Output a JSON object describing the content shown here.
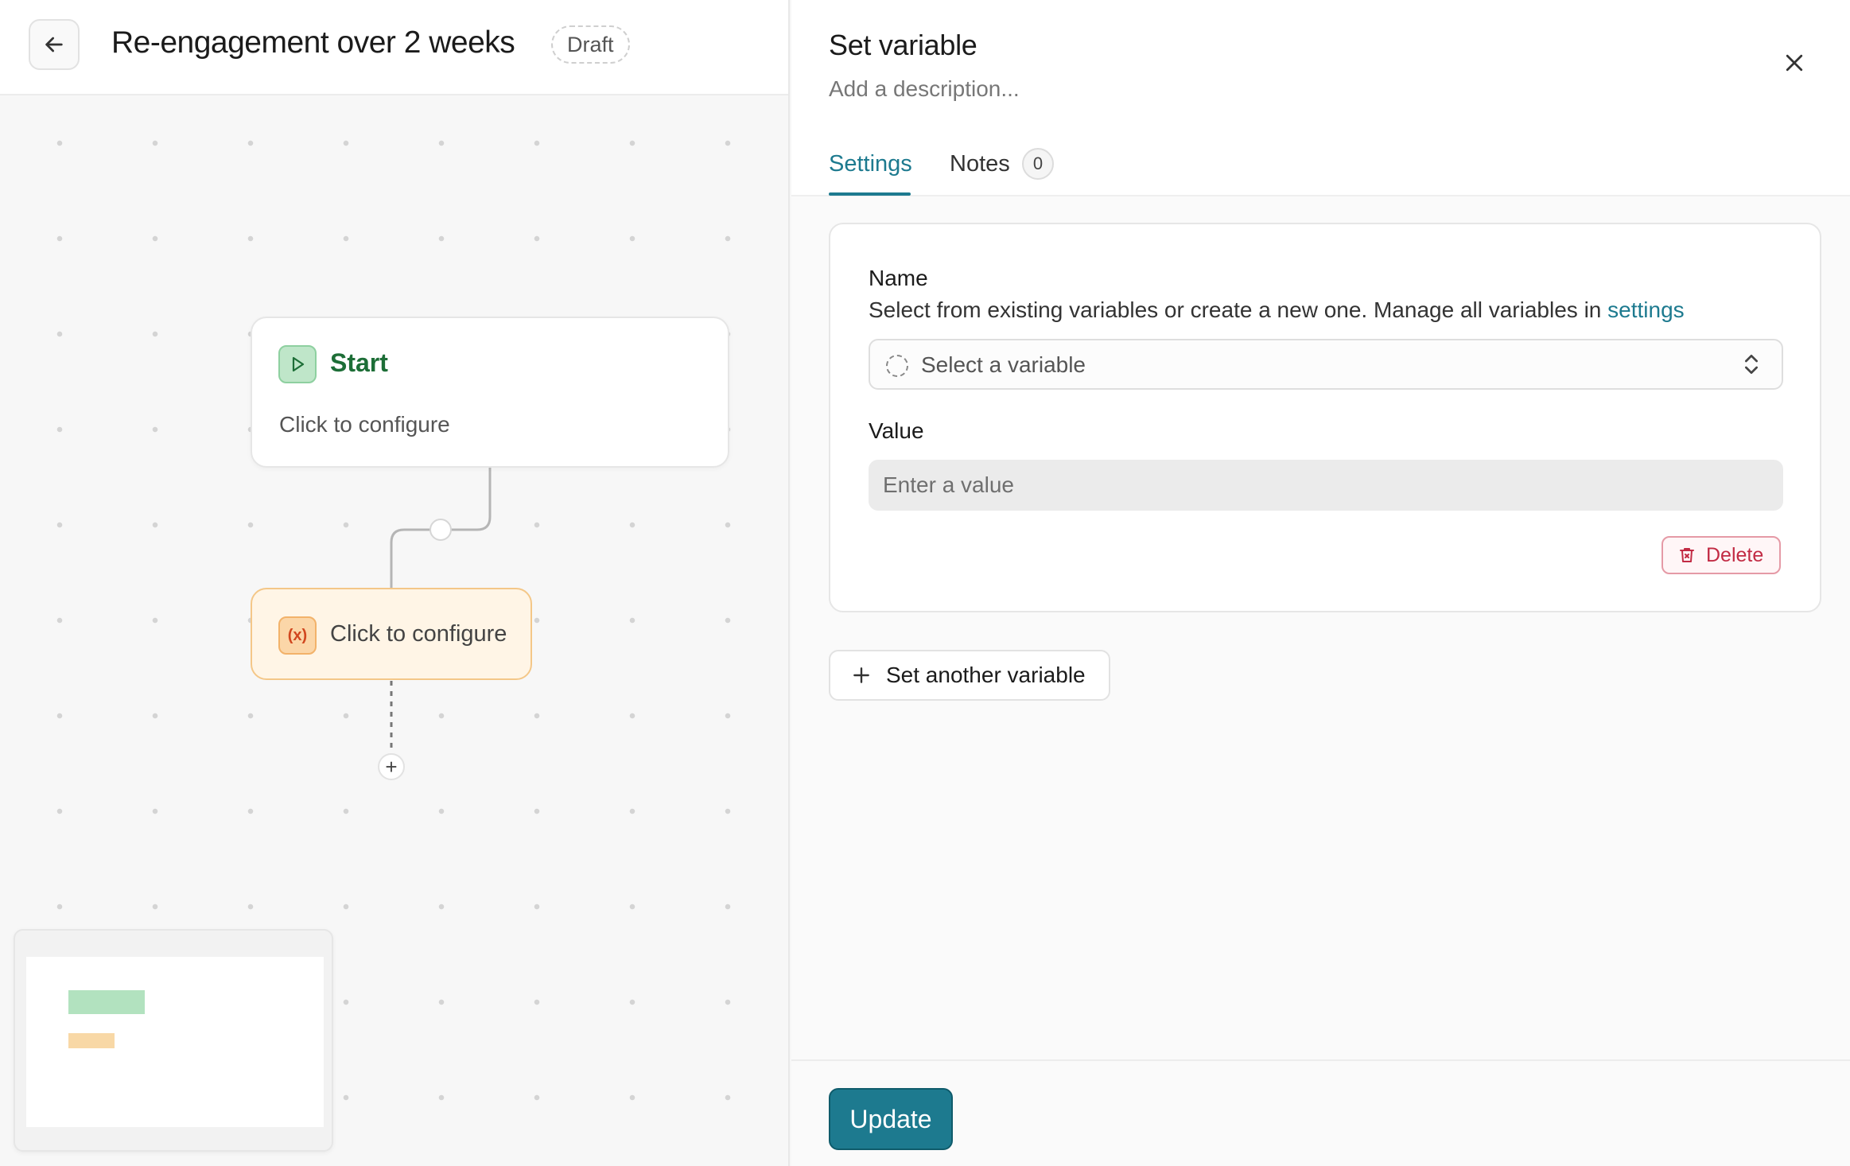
{
  "header": {
    "back_icon": "arrow-left-icon",
    "title": "Re-engagement over 2 weeks",
    "status": "Draft"
  },
  "canvas": {
    "start_node": {
      "icon": "play-icon",
      "title": "Start",
      "subtitle": "Click to configure",
      "accent": "#1d6e37"
    },
    "variable_node": {
      "icon": "variable-icon",
      "icon_glyph": "(x)",
      "label": "Click to configure",
      "accent": "#f4c788"
    },
    "add_step_glyph": "+"
  },
  "panel": {
    "title": "Set variable",
    "description_placeholder": "Add a description...",
    "tabs": [
      {
        "label": "Settings",
        "active": true
      },
      {
        "label": "Notes",
        "count": "0"
      }
    ],
    "name_field": {
      "label": "Name",
      "help_text": "Select from existing variables or create a new one. Manage all variables in ",
      "help_link": "settings",
      "select_placeholder": "Select a variable"
    },
    "value_field": {
      "label": "Value",
      "placeholder": "Enter a value"
    },
    "delete_label": "Delete",
    "add_variable_label": "Set another variable",
    "update_label": "Update",
    "accent_color": "#1d7a8f",
    "danger_color": "#c22b44"
  }
}
